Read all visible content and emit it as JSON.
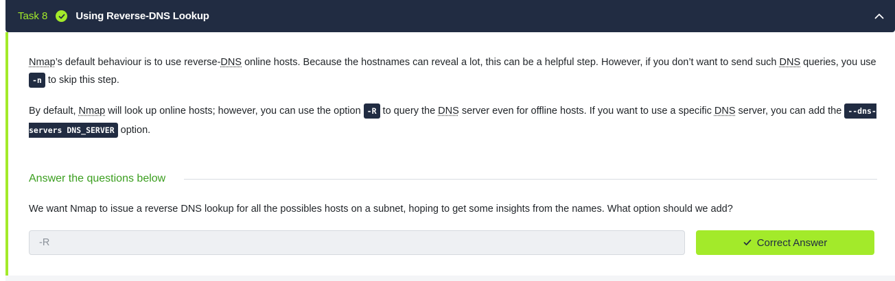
{
  "task": {
    "number_label": "Task 8",
    "title": "Using Reverse-DNS Lookup",
    "completed_icon": "check-circle-icon",
    "collapse_icon": "chevron-up-icon"
  },
  "content": {
    "p1": {
      "t1": "Nmap",
      "t2": "’s default behaviour is to use reverse-",
      "t3": "DNS",
      "t4": " online hosts. Because the hostnames can reveal a lot, this can be a helpful step. However, if you don’t want to send such ",
      "t5": "DNS",
      "t6": " queries, you use ",
      "code1": "-n",
      "t7": " to skip this step."
    },
    "p2": {
      "t1": "By default, ",
      "t2": "Nmap",
      "t3": " will look up online hosts; however, you can use the option ",
      "code1": "-R",
      "t4": " to query the ",
      "t5": "DNS",
      "t6": " server even for offline hosts. If you want to use a specific ",
      "t7": "DNS",
      "t8": " server, you can add the ",
      "code2": "--dns-servers DNS_SERVER",
      "t9": " option."
    }
  },
  "questions": {
    "heading": "Answer the questions below",
    "items": [
      {
        "text": "We want Nmap to issue a reverse DNS lookup for all the possibles hosts on a subnet, hoping to get some insights from the names. What option should we add?",
        "answer_value": "-R",
        "button_label": "Correct Answer"
      }
    ]
  },
  "colors": {
    "header_bg": "#212c42",
    "accent": "#a3ea2a",
    "heading_green": "#3a9e1e"
  }
}
